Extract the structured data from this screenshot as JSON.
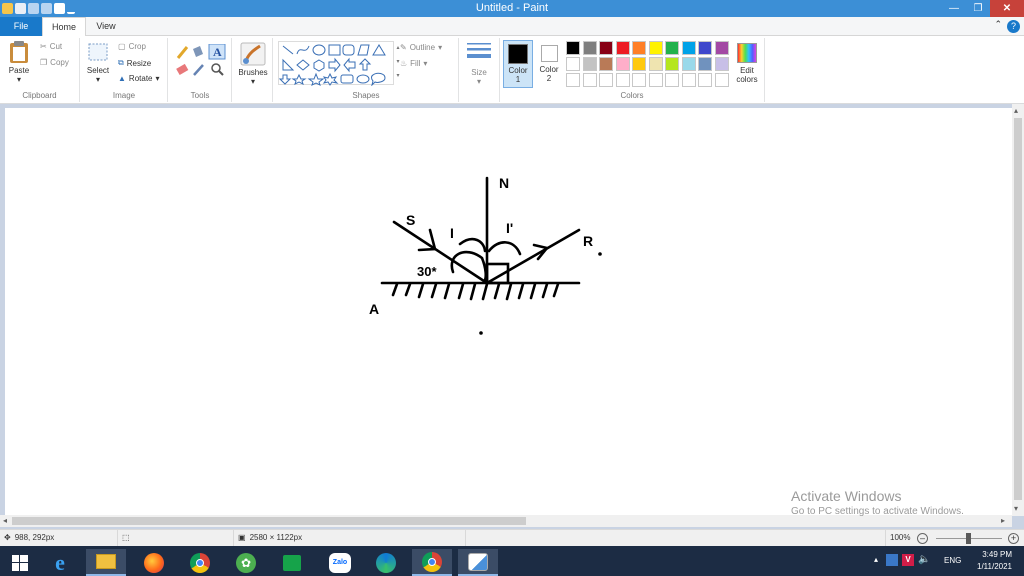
{
  "window": {
    "title": "Untitled - Paint"
  },
  "tabs": {
    "file": "File",
    "home": "Home",
    "view": "View"
  },
  "clipboard": {
    "paste": "Paste",
    "cut": "Cut",
    "copy": "Copy",
    "group_label": "Clipboard"
  },
  "image": {
    "select": "Select",
    "crop": "Crop",
    "resize": "Resize",
    "rotate": "Rotate",
    "group_label": "Image"
  },
  "tools": {
    "group_label": "Tools"
  },
  "brushes": {
    "label": "Brushes"
  },
  "shapes": {
    "outline": "Outline",
    "fill": "Fill",
    "group_label": "Shapes"
  },
  "size": {
    "label": "Size"
  },
  "colors": {
    "color1": "Color 1",
    "color2": "Color 2",
    "edit": "Edit colors",
    "group_label": "Colors",
    "color1_value": "#000000",
    "color2_value": "#ffffff",
    "palette_row1": [
      "#000000",
      "#7f7f7f",
      "#880015",
      "#ed1c24",
      "#ff7f27",
      "#fff200",
      "#22b14c",
      "#00a2e8",
      "#3f48cc",
      "#a349a4"
    ],
    "palette_row2": [
      "#ffffff",
      "#c3c3c3",
      "#b97a57",
      "#ffaec9",
      "#ffc90e",
      "#efe4b0",
      "#b5e61d",
      "#99d9ea",
      "#7092be",
      "#c8bfe7"
    ]
  },
  "drawing": {
    "label_n": "N",
    "label_s": "S",
    "label_i": "I",
    "label_r_prime": "I'",
    "label_r": "R",
    "label_angle": "30*",
    "label_a": "A"
  },
  "watermark": {
    "line1": "Activate Windows",
    "line2": "Go to PC settings to activate Windows."
  },
  "status": {
    "position": "988, 292px",
    "size": "2580 × 1122px",
    "zoom": "100%"
  },
  "taskbar": {
    "zalo": "Zalo",
    "lang": "ENG",
    "time": "3:49 PM",
    "date": "1/11/2021"
  }
}
